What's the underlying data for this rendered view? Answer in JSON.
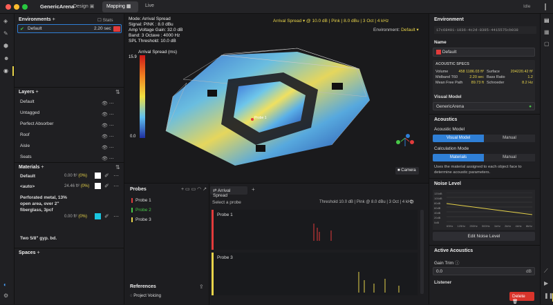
{
  "app": {
    "title": "GenericArena",
    "tabs": [
      {
        "label": "Design"
      },
      {
        "label": "Mapping"
      },
      {
        "label": "Live"
      }
    ],
    "status": "Idle"
  },
  "environments": {
    "title": "Environments",
    "stats_label": "Stats",
    "item": {
      "label": "Default",
      "value": "2.20 sec"
    }
  },
  "layers": {
    "title": "Layers",
    "items": [
      {
        "label": "Default"
      },
      {
        "label": "Untagged"
      },
      {
        "label": "Perfect Absorber"
      },
      {
        "label": "Roof"
      },
      {
        "label": "Aisle"
      },
      {
        "label": "Seats"
      }
    ]
  },
  "materials": {
    "title": "Materials",
    "items": [
      {
        "label": "Default",
        "area": "0.00 ft²",
        "pct": "(0%)"
      },
      {
        "label": "<auto>",
        "area": "24.46 ft²",
        "pct": "(0%)"
      },
      {
        "label": "Perforated metal, 13% open area, over 2\" fiberglass, 3pcf",
        "area": "0.00 ft²",
        "pct": "(0%)"
      },
      {
        "label": "Two 5/8\" gyp. bd."
      }
    ]
  },
  "spaces": {
    "title": "Spaces"
  },
  "viewport": {
    "info": [
      "Mode: Arrival Spread",
      "Signal: PINK : 8.0 dBu",
      "Amp Voltage Gain: 32.0 dB",
      "Band: 3 Octave : 4000 Hz",
      "SPL Threshold: 10.0 dB"
    ],
    "toolbar": {
      "mode": "Arrival Spread",
      "threshold": "10.0 dB",
      "signal": "Pink",
      "level": "8.0 dBu",
      "band": "3 Oct",
      "freq": "4 kHz"
    },
    "environment_label": "Environment:",
    "environment_value": "Default",
    "legend_title": "Arrival Spread (ms)",
    "legend_max": "15.9",
    "legend_min": "0.0",
    "probe_tag": "Probe 1",
    "camera_label": "Camera"
  },
  "probes": {
    "title": "Probes",
    "items": [
      {
        "label": "Probe 1",
        "color": "#e23b3b"
      },
      {
        "label": "Probe 2",
        "color": "#48c848"
      },
      {
        "label": "Probe 3",
        "color": "#e8d44a"
      }
    ],
    "select_label": "Select a probe",
    "tab_label": "Arrival Spread",
    "threshold_text": "Threshold 10.0 dB | Pink @ 8.0 dBu | 3 Oct | 4 kHz",
    "plot1": "Probe 1",
    "plot3": "Probe 3"
  },
  "references": {
    "title": "References",
    "item": "Project Voicing"
  },
  "environment_panel": {
    "title": "Environment",
    "id": "17c68401-1036-4c2d-8395-4415575cb038",
    "name_label": "Name",
    "name": "Default",
    "specs_title": "ACOUSTIC SPECS",
    "specs": [
      {
        "k": "Volume",
        "v": "458 1186.03 ft³"
      },
      {
        "k": "Surface",
        "v": "204220.42 ft²"
      },
      {
        "k": "Midband T60",
        "v": "2.20 sec"
      },
      {
        "k": "Bass Ratio",
        "v": "1.2"
      },
      {
        "k": "Mean Free Path",
        "v": "89.73 ft"
      },
      {
        "k": "Schroeder",
        "v": "8.2 Hz"
      }
    ],
    "visual_model_label": "Visual Model",
    "visual_model": "GenericArena",
    "acoustics_title": "Acoustics",
    "acoustic_model_label": "Acoustic Model",
    "seg_visual": "Visual Model",
    "seg_manual": "Manual",
    "calc_label": "Calculation Mode",
    "seg_materials": "Materials",
    "seg_manual2": "Manual",
    "calc_desc": "Uses the material assigned to each object face to determine acoustic parameters.",
    "noise_title": "Noise Level",
    "noise_y": [
      "120dB",
      "100dB",
      "80dB",
      "60dB",
      "40dB",
      "20dB",
      "0dB"
    ],
    "noise_x": [
      "63Hz",
      "125Hz",
      "250Hz",
      "500Hz",
      "1kHz",
      "2kHz",
      "4kHz",
      "8kHz"
    ],
    "edit_noise": "Edit Noise Level",
    "active_title": "Active Acoustics",
    "gain_label": "Gain Trim",
    "gain_value": "0.0",
    "gain_unit": "dB",
    "listener": "Listener",
    "delete": "Delete"
  }
}
